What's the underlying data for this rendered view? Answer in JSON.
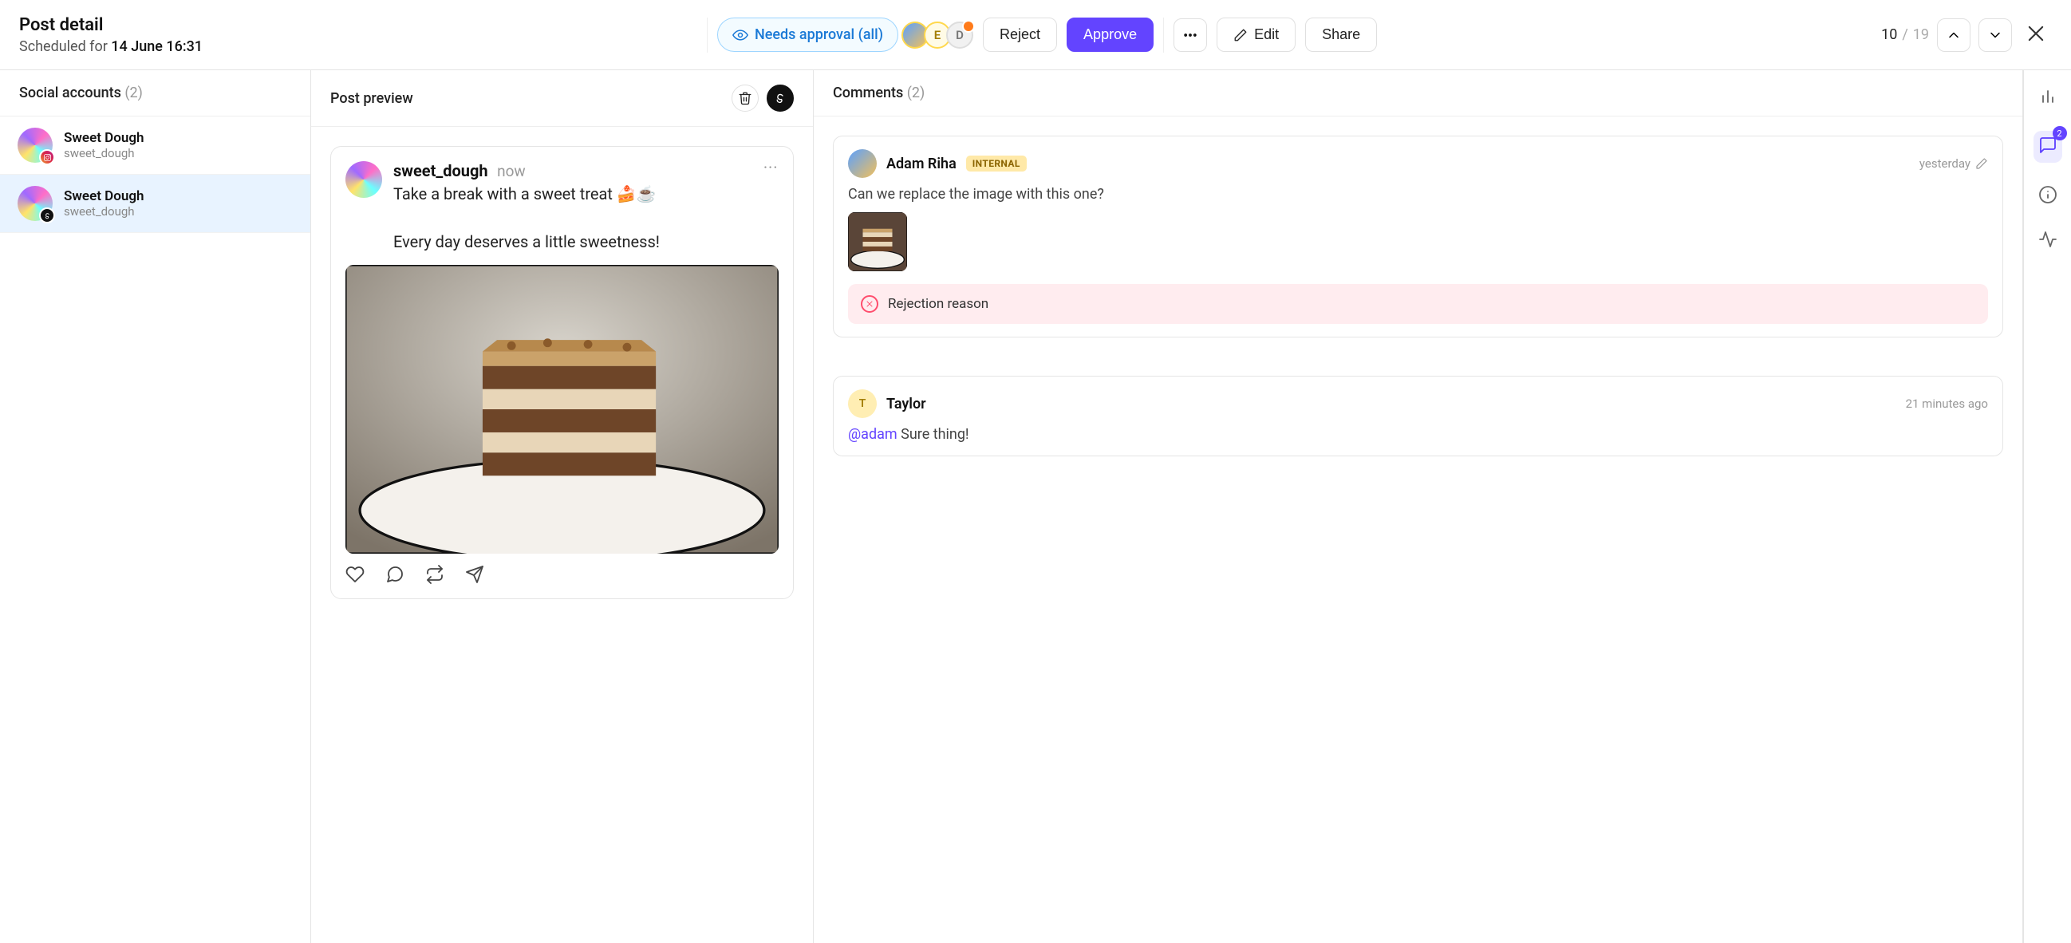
{
  "header": {
    "title": "Post detail",
    "schedule_prefix": "Scheduled for ",
    "schedule_date": "14 June 16:31",
    "approval_pill": "Needs approval (all)",
    "reviewers": [
      {
        "kind": "image",
        "label": ""
      },
      {
        "kind": "letter",
        "label": "E"
      },
      {
        "kind": "letter",
        "label": "D",
        "has_badge": true
      }
    ],
    "reject_label": "Reject",
    "approve_label": "Approve",
    "edit_label": "Edit",
    "share_label": "Share",
    "pager_current": "10",
    "pager_sep": " / ",
    "pager_total": "19"
  },
  "accounts": {
    "section_label": "Social accounts ",
    "count": "(2)",
    "items": [
      {
        "name": "Sweet Dough",
        "handle": "sweet_dough",
        "network": "instagram",
        "active": false
      },
      {
        "name": "Sweet Dough",
        "handle": "sweet_dough",
        "network": "threads",
        "active": true
      }
    ]
  },
  "preview": {
    "section_label": "Post preview",
    "username": "sweet_dough",
    "timestamp": "now",
    "text": "Take a break with a sweet treat 🍰☕\n\nEvery day deserves a little sweetness!"
  },
  "comments": {
    "section_label": "Comments ",
    "count": "(2)",
    "badge_count": "2",
    "items": [
      {
        "author": "Adam Riha",
        "avatar_kind": "image",
        "tag": "INTERNAL",
        "time": "yesterday",
        "body": "Can we replace the image with this one?",
        "has_attachment": true,
        "has_rejection": true,
        "rejection_label": "Rejection reason"
      },
      {
        "author": "Taylor",
        "avatar_kind": "letter",
        "avatar_letter": "T",
        "time": "21 minutes ago",
        "body": "Sure thing!",
        "mention": "@adam"
      }
    ]
  }
}
